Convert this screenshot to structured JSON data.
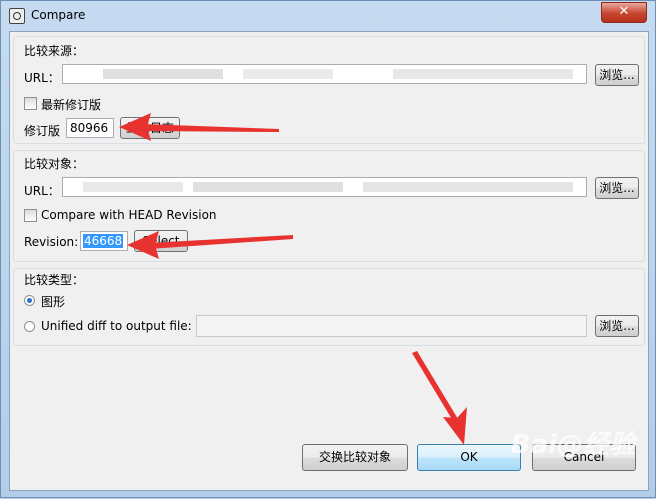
{
  "window": {
    "title": "Compare",
    "close_label": "✕"
  },
  "source": {
    "legend": "比较来源：",
    "url_label": "URL：",
    "browse_label": "浏览...",
    "latest_checkbox_label": "最新修订版",
    "latest_checked": false,
    "revision_label": "修订版",
    "revision_value": "80966",
    "show_log_label": "显示日志"
  },
  "target": {
    "legend": "比较对象：",
    "url_label": "URL：",
    "browse_label": "浏览...",
    "head_checkbox_label": "Compare with HEAD Revision",
    "head_checked": false,
    "revision_label": "Revision:",
    "revision_value": "46668",
    "select_label": "Select"
  },
  "compare_type": {
    "legend": "比较类型：",
    "options": [
      {
        "label": "图形",
        "selected": true
      },
      {
        "label": "Unified diff to output file:",
        "selected": false
      }
    ],
    "browse_label": "浏览..."
  },
  "footer": {
    "swap_label": "交换比较对象",
    "ok_label": "OK",
    "cancel_label": "Cancel"
  },
  "accent_colors": {
    "annotation_arrow": "#e8322f",
    "selection": "#3399ff",
    "close_button": "#c7452f"
  },
  "watermark": "Bai@经验"
}
